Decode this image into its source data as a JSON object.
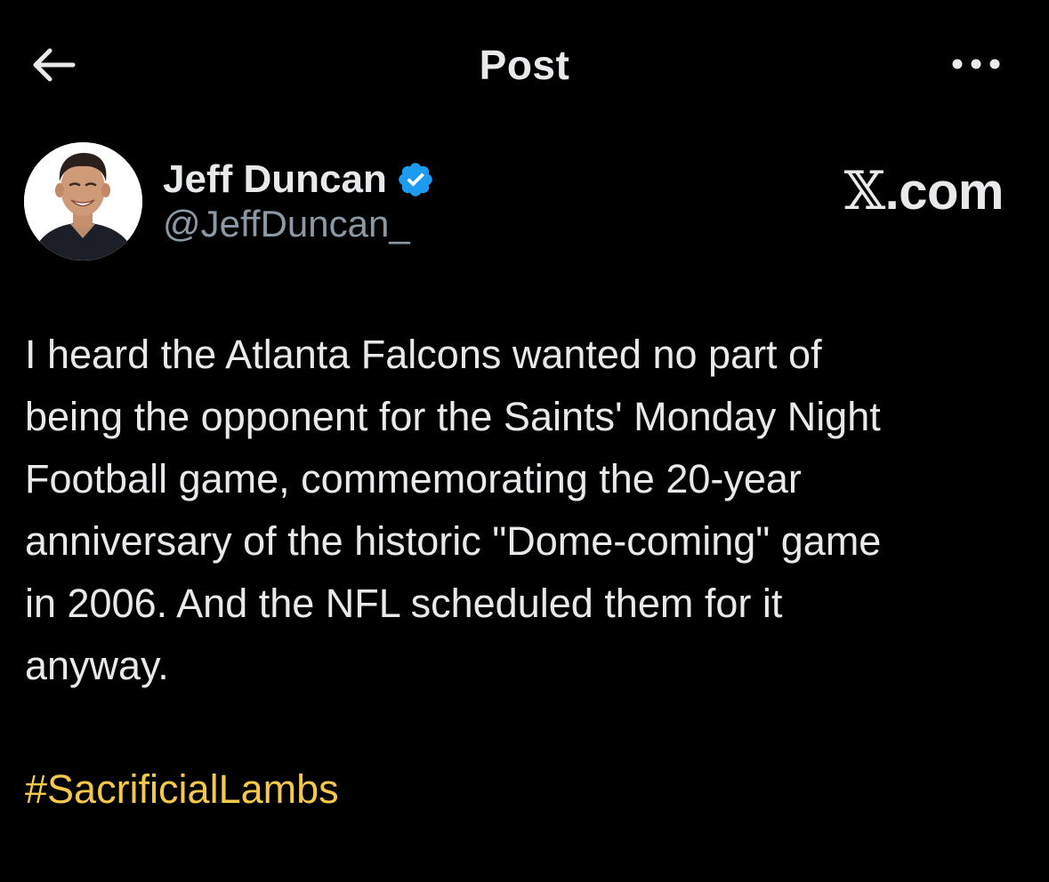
{
  "header": {
    "title": "Post",
    "back_icon": "arrow-left-icon",
    "more_icon": "more-horizontal-icon"
  },
  "author": {
    "display_name": "Jeff Duncan",
    "handle": "@JeffDuncan_",
    "verified_icon": "verified-badge-icon",
    "verified_color": "#1d9bf0"
  },
  "brand": {
    "x_glyph": "𝕏",
    "domain": ".com"
  },
  "post": {
    "text": "I heard the Atlanta Falcons wanted no part of\nbeing the opponent for the Saints' Monday Night\nFootball game, commemorating the 20-year\nanniversary of the historic \"Dome-coming\" game\nin 2006. And the NFL scheduled them for it\nanyway.",
    "hashtag": "#SacrificialLambs",
    "hashtag_color": "#f3c84b"
  },
  "colors": {
    "background": "#000000",
    "primary_text": "#e7e9ea",
    "secondary_text": "#8b98a5"
  }
}
